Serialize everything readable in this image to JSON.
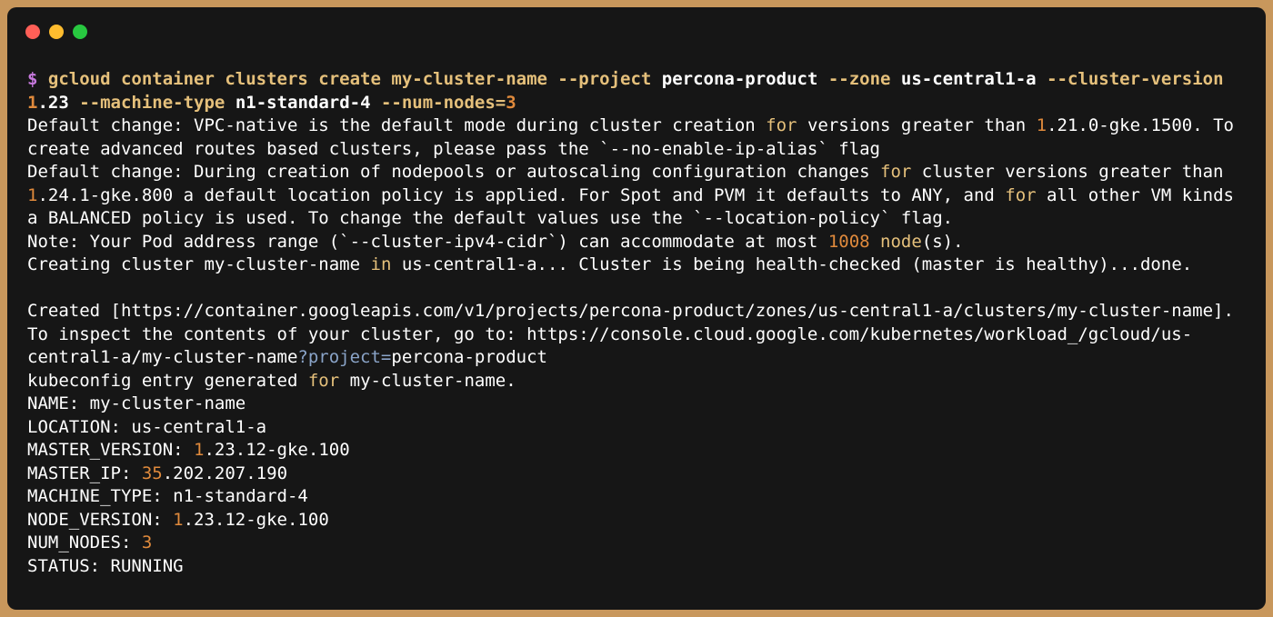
{
  "colors": {
    "background": "#c8975c",
    "terminal_bg": "#161616",
    "close": "#ff5f57",
    "minimize": "#febc2e",
    "maximize": "#28c840",
    "text": "#ffffff",
    "prompt": "#c678dd",
    "keyword": "#e5c07b",
    "number": "#e08a3c",
    "operator": "#8aa4c8"
  },
  "window_controls": {
    "close_icon": "close-dot-icon",
    "minimize_icon": "minimize-dot-icon",
    "maximize_icon": "maximize-dot-icon"
  },
  "terminal": {
    "lines": [
      {
        "name": "command-line",
        "cls": "cmd",
        "tokens": [
          {
            "t": "$ ",
            "c": "prompt"
          },
          {
            "t": "gcloud container clusters create my-cluster-name ",
            "c": "cmd"
          },
          {
            "t": "--project ",
            "c": "flag"
          },
          {
            "t": "percona-product ",
            "c": "arg"
          },
          {
            "t": "--zone ",
            "c": "flag"
          },
          {
            "t": "us-central1-a ",
            "c": "arg"
          },
          {
            "t": "--cluster-version",
            "c": "flag"
          }
        ]
      },
      {
        "name": "command-line-continued",
        "cls": "cmd",
        "tokens": [
          {
            "t": "1",
            "c": "num"
          },
          {
            "t": ".23 ",
            "c": "arg"
          },
          {
            "t": "--machine-type ",
            "c": "flag"
          },
          {
            "t": "n1-standard-4 ",
            "c": "arg"
          },
          {
            "t": "--num-nodes=",
            "c": "flag"
          },
          {
            "t": "3",
            "c": "num"
          }
        ]
      },
      {
        "name": "output-line",
        "tokens": [
          {
            "t": "Default change: VPC-native is the default mode during cluster creation ",
            "c": "arg"
          },
          {
            "t": "for",
            "c": "kw"
          },
          {
            "t": " versions greater than ",
            "c": "arg"
          },
          {
            "t": "1",
            "c": "num"
          },
          {
            "t": ".21.0-gke.1500. To",
            "c": "arg"
          }
        ]
      },
      {
        "name": "output-line",
        "tokens": [
          {
            "t": "create advanced routes based clusters, please pass the `--no-enable-ip-alias` flag",
            "c": "arg"
          }
        ]
      },
      {
        "name": "output-line",
        "tokens": [
          {
            "t": "Default change: During creation of nodepools or autoscaling configuration changes ",
            "c": "arg"
          },
          {
            "t": "for",
            "c": "kw"
          },
          {
            "t": " cluster versions greater than",
            "c": "arg"
          }
        ]
      },
      {
        "name": "output-line",
        "tokens": [
          {
            "t": "1",
            "c": "num"
          },
          {
            "t": ".24.1-gke.800 a default location policy is applied. For Spot and PVM it defaults to ANY, and ",
            "c": "arg"
          },
          {
            "t": "for",
            "c": "kw"
          },
          {
            "t": " all other VM kinds",
            "c": "arg"
          }
        ]
      },
      {
        "name": "output-line",
        "tokens": [
          {
            "t": "a BALANCED policy is used. To change the default values use the `--location-policy` flag.",
            "c": "arg"
          }
        ]
      },
      {
        "name": "output-line",
        "tokens": [
          {
            "t": "Note: Your Pod address range (`--cluster-ipv4-cidr`) can accommodate at most ",
            "c": "arg"
          },
          {
            "t": "1008",
            "c": "num"
          },
          {
            "t": " ",
            "c": "arg"
          },
          {
            "t": "node",
            "c": "kw"
          },
          {
            "t": "(s).",
            "c": "arg"
          }
        ]
      },
      {
        "name": "output-line",
        "tokens": [
          {
            "t": "Creating cluster my-cluster-name ",
            "c": "arg"
          },
          {
            "t": "in",
            "c": "kw"
          },
          {
            "t": " us-central1-a... Cluster is being health-checked (master is healthy)...done.",
            "c": "arg"
          }
        ]
      },
      {
        "name": "blank-line",
        "tokens": [
          {
            "t": " ",
            "c": "arg"
          }
        ]
      },
      {
        "name": "output-line",
        "tokens": [
          {
            "t": "Created [https://container.googleapis.com/v1/projects/percona-product/zones/us-central1-a/clusters/my-cluster-name].",
            "c": "arg"
          }
        ]
      },
      {
        "name": "output-line",
        "tokens": [
          {
            "t": "To inspect the contents of your cluster, go to: https://console.cloud.google.com/kubernetes/workload_/gcloud/us-",
            "c": "arg"
          }
        ]
      },
      {
        "name": "output-line",
        "tokens": [
          {
            "t": "central1-a/my-cluster-name",
            "c": "arg"
          },
          {
            "t": "?project=",
            "c": "op"
          },
          {
            "t": "percona-product",
            "c": "arg"
          }
        ]
      },
      {
        "name": "output-line",
        "tokens": [
          {
            "t": "kubeconfig entry generated ",
            "c": "arg"
          },
          {
            "t": "for",
            "c": "kw"
          },
          {
            "t": " my-cluster-name.",
            "c": "arg"
          }
        ]
      },
      {
        "name": "output-line",
        "tokens": [
          {
            "t": "NAME: my-cluster-name",
            "c": "arg"
          }
        ]
      },
      {
        "name": "output-line",
        "tokens": [
          {
            "t": "LOCATION: us-central1-a",
            "c": "arg"
          }
        ]
      },
      {
        "name": "output-line",
        "tokens": [
          {
            "t": "MASTER_VERSION: ",
            "c": "arg"
          },
          {
            "t": "1",
            "c": "num"
          },
          {
            "t": ".23.12-gke.100",
            "c": "arg"
          }
        ]
      },
      {
        "name": "output-line",
        "tokens": [
          {
            "t": "MASTER_IP: ",
            "c": "arg"
          },
          {
            "t": "35",
            "c": "num"
          },
          {
            "t": ".202.207.190",
            "c": "arg"
          }
        ]
      },
      {
        "name": "output-line",
        "tokens": [
          {
            "t": "MACHINE_TYPE: n1-standard-4",
            "c": "arg"
          }
        ]
      },
      {
        "name": "output-line",
        "tokens": [
          {
            "t": "NODE_VERSION: ",
            "c": "arg"
          },
          {
            "t": "1",
            "c": "num"
          },
          {
            "t": ".23.12-gke.100",
            "c": "arg"
          }
        ]
      },
      {
        "name": "output-line",
        "tokens": [
          {
            "t": "NUM_NODES: ",
            "c": "arg"
          },
          {
            "t": "3",
            "c": "num"
          }
        ]
      },
      {
        "name": "output-line",
        "tokens": [
          {
            "t": "STATUS: RUNNING",
            "c": "arg"
          }
        ]
      }
    ]
  }
}
